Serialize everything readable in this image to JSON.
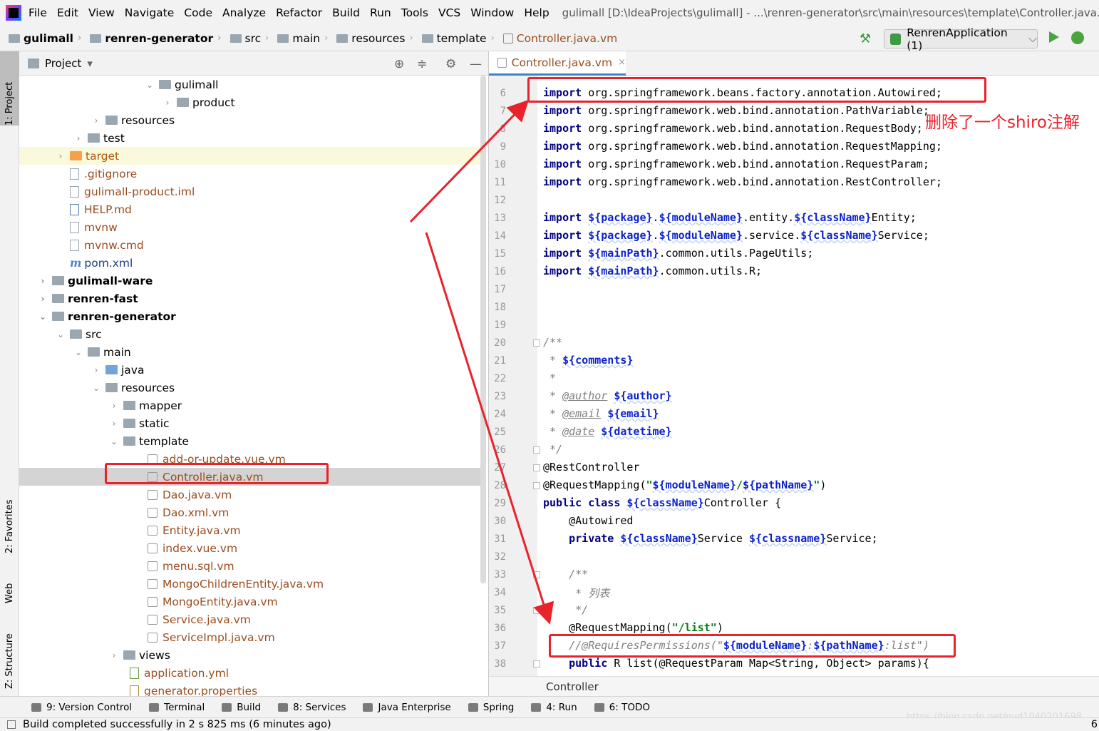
{
  "menubar": {
    "items": [
      "File",
      "Edit",
      "View",
      "Navigate",
      "Code",
      "Analyze",
      "Refactor",
      "Build",
      "Run",
      "Tools",
      "VCS",
      "Window",
      "Help"
    ],
    "window_title": "gulimall [D:\\IdeaProjects\\gulimall] - ...\\renren-generator\\src\\main\\resources\\template\\Controller.java.vm"
  },
  "breadcrumbs": [
    "gulimall",
    "renren-generator",
    "src",
    "main",
    "resources",
    "template",
    "Controller.java.vm"
  ],
  "run_config": {
    "label": "RenrenApplication (1)",
    "chevron": "⌵"
  },
  "left_strip": {
    "project": "1: Project",
    "favorites": "2: Favorites",
    "web": "Web",
    "structure": "Z: Structure"
  },
  "project_panel": {
    "title": "Project",
    "dropdown": "▾"
  },
  "tree": [
    {
      "label": "gulimall",
      "arrow": "⌄",
      "icon": "folder"
    },
    {
      "label": "product",
      "arrow": "›",
      "icon": "folder"
    },
    {
      "label": "resources",
      "arrow": "›",
      "icon": "folder"
    },
    {
      "label": "test",
      "arrow": "›",
      "icon": "folder"
    },
    {
      "label": "target",
      "arrow": "›",
      "icon": "folder-orange"
    },
    {
      "label": ".gitignore",
      "arrow": "",
      "icon": "file"
    },
    {
      "label": "gulimall-product.iml",
      "arrow": "",
      "icon": "file"
    },
    {
      "label": "HELP.md",
      "arrow": "",
      "icon": "md-file"
    },
    {
      "label": "mvnw",
      "arrow": "",
      "icon": "file"
    },
    {
      "label": "mvnw.cmd",
      "arrow": "",
      "icon": "file"
    },
    {
      "label": "pom.xml",
      "arrow": "",
      "icon": "maven",
      "mark": "m"
    },
    {
      "label": "gulimall-ware",
      "arrow": "›",
      "icon": "module-folder"
    },
    {
      "label": "renren-fast",
      "arrow": "›",
      "icon": "module-folder"
    },
    {
      "label": "renren-generator",
      "arrow": "⌄",
      "icon": "module-folder"
    },
    {
      "label": "src",
      "arrow": "⌄",
      "icon": "folder"
    },
    {
      "label": "main",
      "arrow": "⌄",
      "icon": "folder"
    },
    {
      "label": "java",
      "arrow": "›",
      "icon": "source-folder"
    },
    {
      "label": "resources",
      "arrow": "⌄",
      "icon": "resources-folder"
    },
    {
      "label": "mapper",
      "arrow": "›",
      "icon": "folder"
    },
    {
      "label": "static",
      "arrow": "›",
      "icon": "folder"
    },
    {
      "label": "template",
      "arrow": "⌄",
      "icon": "folder"
    },
    {
      "label": "add-or-update.vue.vm",
      "arrow": "",
      "icon": "vm-file"
    },
    {
      "label": "Controller.java.vm",
      "arrow": "",
      "icon": "vm-file"
    },
    {
      "label": "Dao.java.vm",
      "arrow": "",
      "icon": "vm-file"
    },
    {
      "label": "Dao.xml.vm",
      "arrow": "",
      "icon": "vm-file"
    },
    {
      "label": "Entity.java.vm",
      "arrow": "",
      "icon": "vm-file"
    },
    {
      "label": "index.vue.vm",
      "arrow": "",
      "icon": "vm-file"
    },
    {
      "label": "menu.sql.vm",
      "arrow": "",
      "icon": "vm-file"
    },
    {
      "label": "MongoChildrenEntity.java.vm",
      "arrow": "",
      "icon": "vm-file"
    },
    {
      "label": "MongoEntity.java.vm",
      "arrow": "",
      "icon": "vm-file"
    },
    {
      "label": "Service.java.vm",
      "arrow": "",
      "icon": "vm-file"
    },
    {
      "label": "ServiceImpl.java.vm",
      "arrow": "",
      "icon": "vm-file"
    },
    {
      "label": "views",
      "arrow": "›",
      "icon": "folder"
    },
    {
      "label": "application.yml",
      "arrow": "",
      "icon": "yml-file"
    },
    {
      "label": "generator.properties",
      "arrow": "",
      "icon": "properties-file"
    }
  ],
  "editor": {
    "tab": {
      "label": "Controller.java.vm",
      "close": "×"
    },
    "footer": "Controller",
    "line_numbers": [
      "6",
      "7",
      "8",
      "9",
      "10",
      "11",
      "12",
      "13",
      "14",
      "15",
      "16",
      "17",
      "18",
      "19",
      "20",
      "21",
      "22",
      "23",
      "24",
      "25",
      "26",
      "27",
      "28",
      "29",
      "30",
      "31",
      "32",
      "33",
      "34",
      "35",
      "36",
      "37",
      "38"
    ],
    "code": {
      "import": "import",
      "l6": " org.springframework.beans.factory.annotation.Autowired;",
      "l7": " org.springframework.web.bind.annotation.PathVariable;",
      "l8": " org.springframework.web.bind.annotation.RequestBody;",
      "l9": " org.springframework.web.bind.annotation.RequestMapping;",
      "l10": " org.springframework.web.bind.annotation.RequestParam;",
      "l11": " org.springframework.web.bind.annotation.RestController;",
      "package": "${package}",
      "moduleName": "${moduleName}",
      "className": "${className}",
      "classname": "${classname}",
      "mainPath": "${mainPath}",
      "pathName": "${pathName}",
      "comments": "${comments}",
      "author": "${author}",
      "email": "${email}",
      "datetime": "${datetime}",
      "l13_tail": ".entity.",
      "l13_end": "Entity;",
      "l14_tail": ".service.",
      "l14_end": "Service;",
      "l15_tail": ".common.utils.PageUtils;",
      "l16_tail": ".common.utils.R;",
      "dot": ".",
      "space": " ",
      "doc_open": "/**",
      "star": " * ",
      "star_only": " *",
      "doc_close": " */",
      "at_author": "@author",
      "at_email": "@email",
      "at_date": "@date",
      "rest_controller": "@RestController",
      "req_mapping_open": "@RequestMapping(",
      "quote": "\"",
      "slash": "/",
      "close_paren": ")",
      "public_class": "public class",
      "controller_brace": "Controller {",
      "autowired": "    @Autowired",
      "private": "    private",
      "service_space": "Service ",
      "service_semi": "Service;",
      "doc2_open": "    /**",
      "doc2_star": "     * ",
      "zh_list": "列表",
      "doc2_close": "     */",
      "req_list_open": "    @RequestMapping(",
      "str_list": "\"/list\"",
      "l37_cmt": "    //@RequiresPermissions(\"",
      "colon": ":",
      "l37_end": ":list\")",
      "public_kw": "    public",
      "l38_tail": " R list(@RequestParam Map<String, Object> params){"
    }
  },
  "annotation_note": "删除了一个shiro注解",
  "bottom_tools": [
    "9: Version Control",
    "Terminal",
    "Build",
    "8: Services",
    "Java Enterprise",
    "Spring",
    "4: Run",
    "6: TODO"
  ],
  "status": "Build completed successfully in 2 s 825 ms (6 minutes ago)",
  "status_right": "6",
  "watermark": "https://blog.csdn.net/pyd1040201698",
  "colors": {
    "annotation": "#e8232b",
    "keyword": "#000080",
    "template_var": "#0b22cc",
    "string": "#067d17",
    "comment": "#808080",
    "file_brown": "#9b4d1f"
  }
}
